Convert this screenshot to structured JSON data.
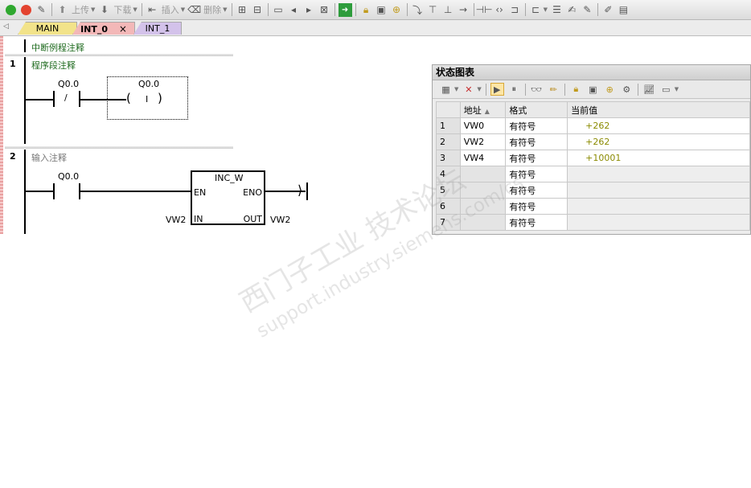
{
  "toolbar": {
    "upload_label": "上传",
    "download_label": "下载",
    "insert_label": "插入",
    "delete_label": "删除"
  },
  "tabs": [
    {
      "label": "MAIN"
    },
    {
      "label": "INT_0"
    },
    {
      "label": "INT_1"
    }
  ],
  "editor": {
    "routine_comment": "中断例程注释",
    "networks": [
      {
        "number": "1",
        "comment": "程序段注释",
        "contact_label": "Q0.0",
        "contact_symbol": "/",
        "coil_label": "Q0.0",
        "coil_symbol": "I"
      },
      {
        "number": "2",
        "comment": "输入注释",
        "contact_label": "Q0.0",
        "block_name": "INC_W",
        "en_label": "EN",
        "eno_label": "ENO",
        "in_label": "IN",
        "out_label": "OUT",
        "in_operand": "VW2",
        "out_operand": "VW2"
      }
    ]
  },
  "status_chart": {
    "title": "状态图表",
    "columns": [
      "地址",
      "格式",
      "当前值"
    ],
    "rows": [
      {
        "n": "1",
        "address": "VW0",
        "format": "有符号",
        "value": "+262"
      },
      {
        "n": "2",
        "address": "VW2",
        "format": "有符号",
        "value": "+262"
      },
      {
        "n": "3",
        "address": "VW4",
        "format": "有符号",
        "value": "+10001"
      },
      {
        "n": "4",
        "address": "",
        "format": "有符号",
        "value": ""
      },
      {
        "n": "5",
        "address": "",
        "format": "有符号",
        "value": ""
      },
      {
        "n": "6",
        "address": "",
        "format": "有符号",
        "value": ""
      },
      {
        "n": "7",
        "address": "",
        "format": "有符号",
        "value": ""
      }
    ]
  },
  "watermark": {
    "line1": "西门子工业 技术论坛",
    "line2": "support.industry.siemens.com/cs"
  }
}
